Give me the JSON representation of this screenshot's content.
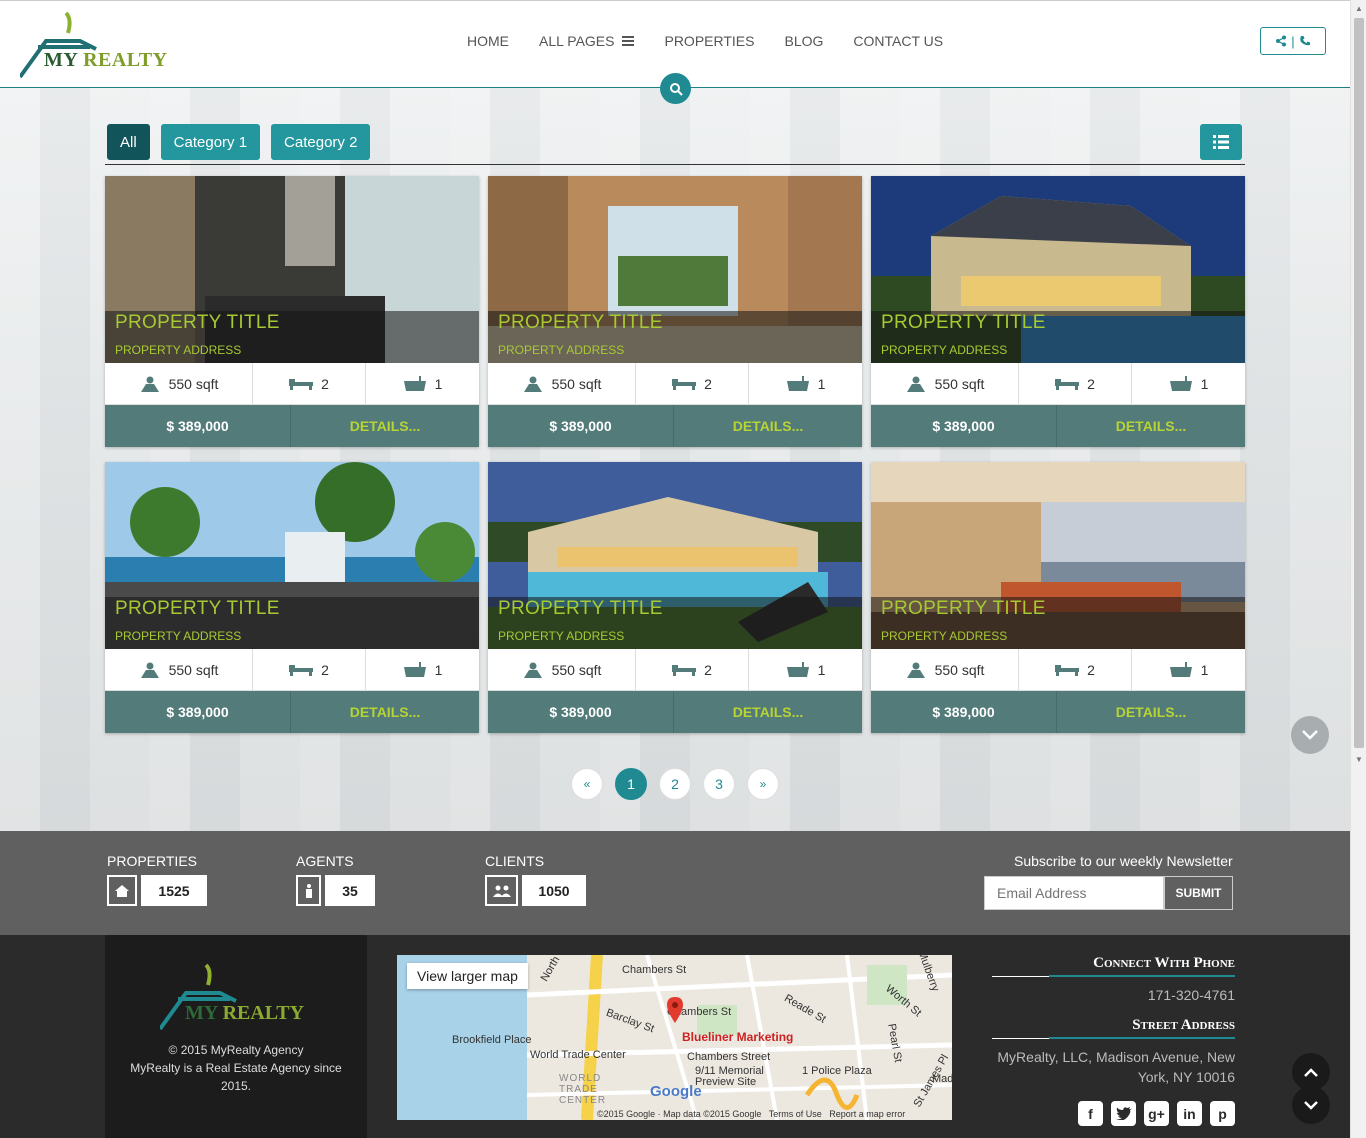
{
  "header": {
    "logo_text_1": "MY ",
    "logo_text_2": "REALTY",
    "nav": [
      {
        "label": "HOME"
      },
      {
        "label": "ALL PAGES"
      },
      {
        "label": "PROPERTIES"
      },
      {
        "label": "BLOG"
      },
      {
        "label": "CONTACT US"
      }
    ],
    "share_separator": "|"
  },
  "filters": {
    "items": [
      {
        "label": "All",
        "active": true
      },
      {
        "label": "Category 1",
        "active": false
      },
      {
        "label": "Category 2",
        "active": false
      }
    ]
  },
  "properties": [
    {
      "title": "PROPERTY TITLE",
      "address": "PROPERTY ADDRESS",
      "area": "550 sqft",
      "beds": "2",
      "baths": "1",
      "price": "$ 389,000",
      "details": "DETAILS...",
      "scene": "interior-dining"
    },
    {
      "title": "PROPERTY TITLE",
      "address": "PROPERTY ADDRESS",
      "area": "550 sqft",
      "beds": "2",
      "baths": "1",
      "price": "$ 389,000",
      "details": "DETAILS...",
      "scene": "interior-atrium"
    },
    {
      "title": "PROPERTY TITLE",
      "address": "PROPERTY ADDRESS",
      "area": "550 sqft",
      "beds": "2",
      "baths": "1",
      "price": "$ 389,000",
      "details": "DETAILS...",
      "scene": "house-night"
    },
    {
      "title": "PROPERTY TITLE",
      "address": "PROPERTY ADDRESS",
      "area": "550 sqft",
      "beds": "2",
      "baths": "1",
      "price": "$ 389,000",
      "details": "DETAILS...",
      "scene": "terrace-palms"
    },
    {
      "title": "PROPERTY TITLE",
      "address": "PROPERTY ADDRESS",
      "area": "550 sqft",
      "beds": "2",
      "baths": "1",
      "price": "$ 389,000",
      "details": "DETAILS...",
      "scene": "villa-pool"
    },
    {
      "title": "PROPERTY TITLE",
      "address": "PROPERTY ADDRESS",
      "area": "550 sqft",
      "beds": "2",
      "baths": "1",
      "price": "$ 389,000",
      "details": "DETAILS...",
      "scene": "living-room"
    }
  ],
  "pagination": {
    "prev": "«",
    "pages": [
      "1",
      "2",
      "3"
    ],
    "active": "1",
    "next": "»"
  },
  "stats": {
    "properties": {
      "label": "PROPERTIES",
      "value": "1525"
    },
    "agents": {
      "label": "AGENTS",
      "value": "35"
    },
    "clients": {
      "label": "CLIENTS",
      "value": "1050"
    }
  },
  "newsletter": {
    "title": "Subscribe to our weekly Newsletter",
    "placeholder": "Email Address",
    "submit": "SUBMIT"
  },
  "footer": {
    "logo_text_1": "MY ",
    "logo_text_2": "REALTY",
    "copyright": "© 2015 MyRealty Agency",
    "about": "MyRealty is a Real Estate Agency since 2015.",
    "map": {
      "view_larger": "View larger map",
      "marker_label": "Blueliner Marketing",
      "labels": [
        "Chambers St",
        "Chambers St",
        "Chambers Street",
        "Barclay St",
        "Reade St",
        "Worth St",
        "Brookfield Place",
        "World Trade Center",
        "9/11 Memorial Preview Site",
        "1 Police Plaza",
        "WORLD TRADE CENTER",
        "Pearl St",
        "St James Pl",
        "North",
        "Mulberry",
        "Mad"
      ],
      "attribution": "©2015 Google · Map data ©2015 Google",
      "terms": "Terms of Use",
      "report": "Report a map error",
      "google": "Google"
    },
    "phone_heading": "Connect With Phone",
    "phone": "171-320-4761",
    "address_heading": "Street Address",
    "address": "MyRealty, LLC, Madison Avenue, New York, NY 10016",
    "socials": [
      "facebook-icon",
      "twitter-icon",
      "google-plus-icon",
      "linkedin-icon",
      "pinterest-icon"
    ]
  }
}
